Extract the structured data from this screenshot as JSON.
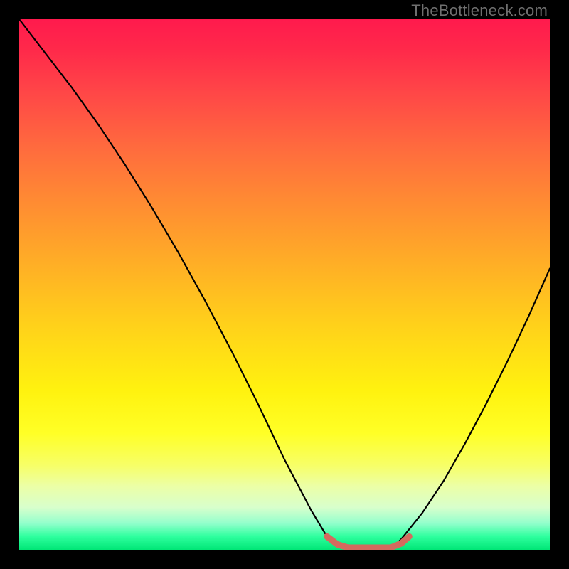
{
  "watermark": "TheBottleneck.com",
  "chart_data": {
    "type": "line",
    "title": "",
    "xlabel": "",
    "ylabel": "",
    "xlim": [
      0,
      100
    ],
    "ylim": [
      0,
      100
    ],
    "grid": false,
    "series": [
      {
        "name": "curve",
        "x": [
          0,
          5,
          10,
          15,
          20,
          25,
          30,
          35,
          40,
          45,
          50,
          55,
          58,
          62,
          66,
          70,
          72,
          76,
          80,
          84,
          88,
          92,
          96,
          100
        ],
        "values": [
          100,
          93.5,
          87,
          80,
          72.5,
          64.5,
          56,
          47,
          37.5,
          27.5,
          17,
          7.5,
          2.5,
          0,
          0,
          0,
          2,
          7,
          13,
          20,
          27.5,
          35.5,
          44,
          53
        ]
      }
    ],
    "flat_segment": {
      "color": "#d46a5e",
      "points": [
        {
          "x": 58,
          "y": 2.5
        },
        {
          "x": 60,
          "y": 1.0
        },
        {
          "x": 62,
          "y": 0.4
        },
        {
          "x": 66,
          "y": 0.4
        },
        {
          "x": 70,
          "y": 0.4
        },
        {
          "x": 72,
          "y": 1.2
        },
        {
          "x": 73.5,
          "y": 2.5
        }
      ]
    },
    "background_gradient": {
      "top": "#ff1a4d",
      "mid": "#ffd21a",
      "bottom": "#00e676"
    }
  }
}
